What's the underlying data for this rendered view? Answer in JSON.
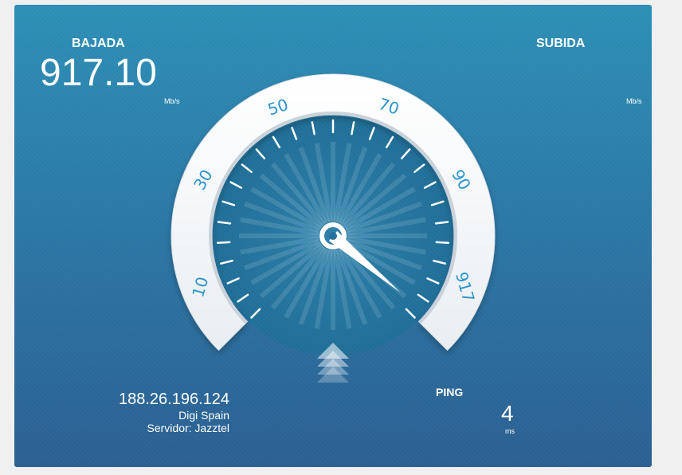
{
  "download": {
    "label": "BAJADA",
    "value": "917.10",
    "unit": "Mb/s"
  },
  "upload": {
    "label": "SUBIDA",
    "value": "",
    "unit": "Mb/s"
  },
  "gauge": {
    "scale_labels": [
      "10",
      "30",
      "50",
      "70",
      "90",
      "917"
    ],
    "needle_value": 917,
    "colors": {
      "dial_text": "#2a93cc",
      "panel_top": "#2c8fb5",
      "panel_bottom": "#2a5f92"
    }
  },
  "connection": {
    "ip": "188.26.196.124",
    "isp": "Digi Spain",
    "server": "Servidor: Jazztel"
  },
  "ping": {
    "label": "PING",
    "value": "4",
    "unit": "ms"
  },
  "icons": {
    "start": "upload-arrows-icon"
  }
}
